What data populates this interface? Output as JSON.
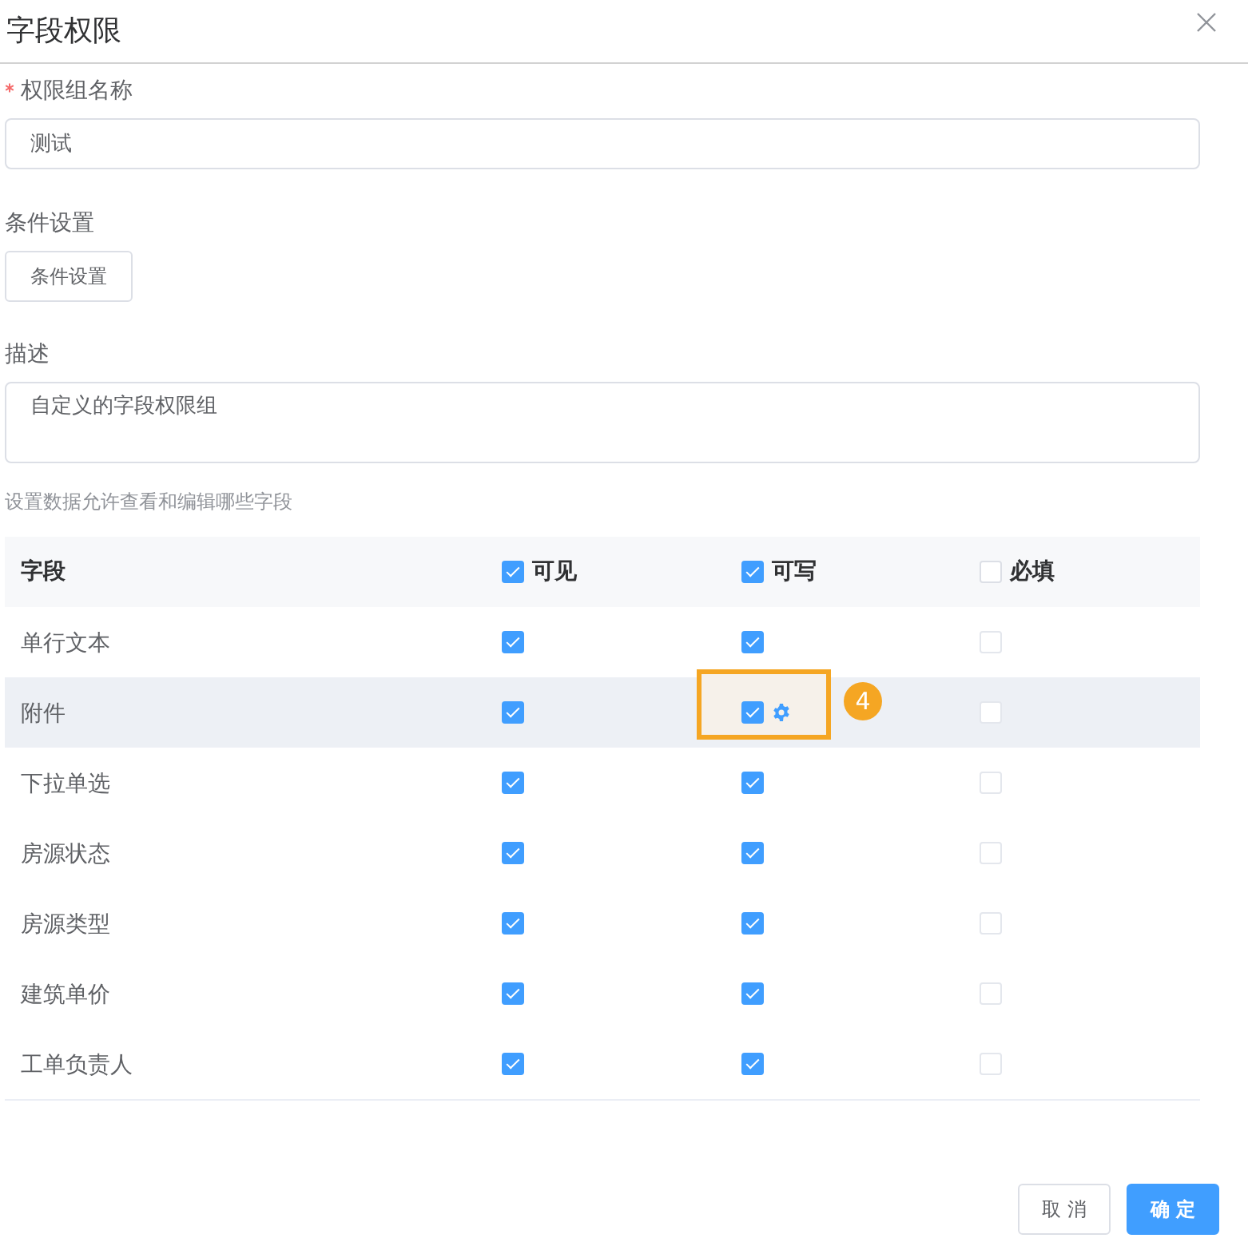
{
  "dialog": {
    "title": "字段权限"
  },
  "form": {
    "name_field": {
      "label": "权限组名称",
      "required": true,
      "value": "测试"
    },
    "condition": {
      "label": "条件设置",
      "button": "条件设置"
    },
    "description": {
      "label": "描述",
      "value": "自定义的字段权限组"
    },
    "hint": "设置数据允许查看和编辑哪些字段"
  },
  "table": {
    "columns": [
      {
        "kind": "text",
        "label": "字段"
      },
      {
        "kind": "checkbox",
        "label": "可见",
        "checked": true
      },
      {
        "kind": "checkbox",
        "label": "可写",
        "checked": true
      },
      {
        "kind": "checkbox",
        "label": "必填",
        "checked": false
      }
    ],
    "rows": [
      {
        "field": "单行文本",
        "visible": true,
        "writable": true,
        "required": false,
        "hovered": false,
        "settings_icon": false
      },
      {
        "field": "附件",
        "visible": true,
        "writable": true,
        "required": false,
        "hovered": true,
        "settings_icon": true,
        "callout": {
          "number": "4"
        }
      },
      {
        "field": "下拉单选",
        "visible": true,
        "writable": true,
        "required": false,
        "hovered": false,
        "settings_icon": false
      },
      {
        "field": "房源状态",
        "visible": true,
        "writable": true,
        "required": false,
        "hovered": false,
        "settings_icon": false
      },
      {
        "field": "房源类型",
        "visible": true,
        "writable": true,
        "required": false,
        "hovered": false,
        "settings_icon": false
      },
      {
        "field": "建筑单价",
        "visible": true,
        "writable": true,
        "required": false,
        "hovered": false,
        "settings_icon": false
      },
      {
        "field": "工单负责人",
        "visible": true,
        "writable": true,
        "required": false,
        "hovered": false,
        "settings_icon": false
      }
    ]
  },
  "footer": {
    "buttons": [
      {
        "kind": "secondary",
        "label": "取 消"
      },
      {
        "kind": "primary",
        "label": "确 定"
      }
    ]
  }
}
